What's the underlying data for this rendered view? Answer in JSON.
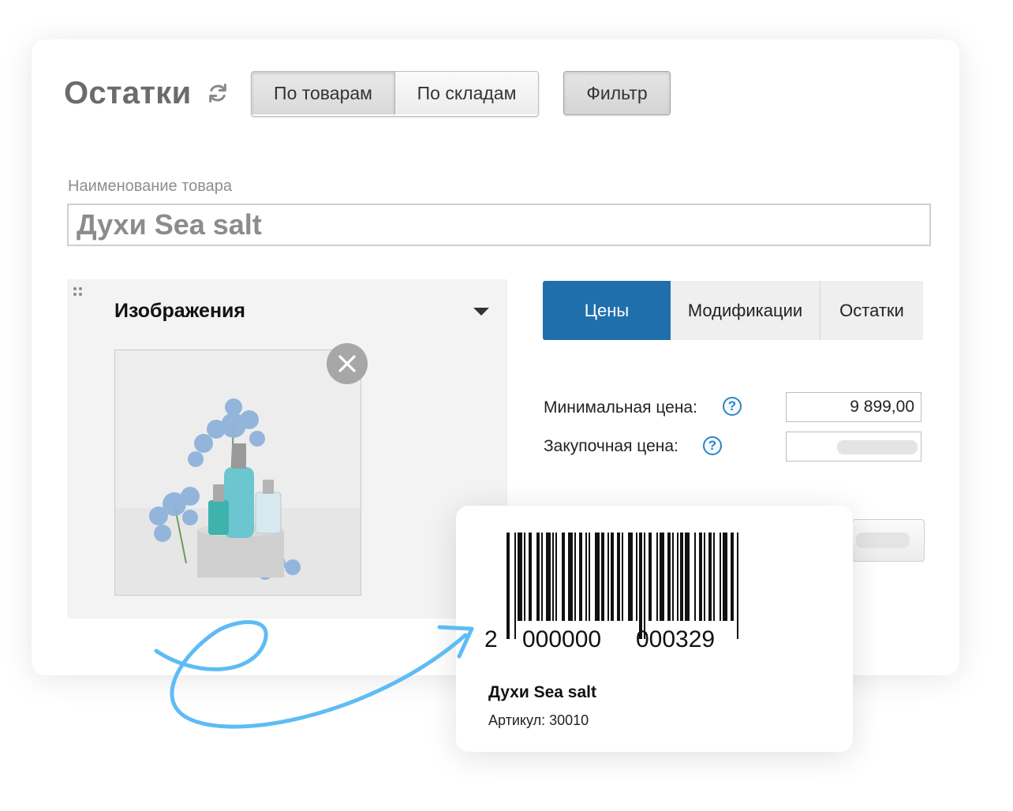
{
  "header": {
    "title": "Остатки",
    "view_tabs": [
      "По товарам",
      "По складам"
    ],
    "filter_label": "Фильтр"
  },
  "product": {
    "name_label": "Наименование товара",
    "name_value": "Духи Sea salt"
  },
  "images_panel": {
    "title": "Изображения"
  },
  "detail_tabs": [
    "Цены",
    "Модификации",
    "Остатки"
  ],
  "prices": {
    "min_price_label": "Минимальная цена:",
    "min_price_value": "9 899,00",
    "purchase_price_label": "Закупочная цена:",
    "help_symbol": "?"
  },
  "barcode_label": {
    "digits_first": "2",
    "digits_mid": "000000",
    "digits_last": "000329",
    "product_name": "Духи Sea salt",
    "article": "Артикул: 30010"
  },
  "colors": {
    "accent": "#1f6fad",
    "arrow": "#5ebcf4"
  }
}
